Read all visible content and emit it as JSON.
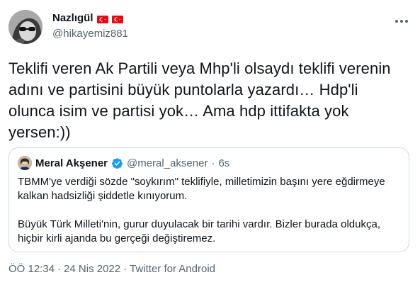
{
  "author": {
    "display_name": "Nazlıgül",
    "flags": [
      "turkey-flag",
      "turkey-flag"
    ],
    "handle": "@hikayemiz881"
  },
  "tweet": {
    "text": "Teklifi veren Ak Partili veya Mhp'li olsaydı teklifi verenin\nadını ve partisini büyük puntolarla yazardı… Hdp'li\nolunca isim ve partisi yok… Ama hdp ittifakta yok\nyersen:))"
  },
  "quoted_tweet": {
    "display_name": "Meral Akşener",
    "handle": "@meral_aksener",
    "separator": "·",
    "time": "6s",
    "paragraph1": "TBMM'ye verdiği sözde \"soykırım\" teklifiyle, milletimizin başını yere eğdirmeye kalkan hadsizliği şiddetle kınıyorum.",
    "paragraph2": "Büyük Türk Milleti'nin, gurur duyulacak bir tarihi vardır. Bizler burada oldukça, hiçbir kirli ajanda bu gerçeği değiştiremez."
  },
  "meta": {
    "time": "ÖÖ 12:34",
    "separator1": "·",
    "date": "24 Nis 2022",
    "separator2": "·",
    "source": "Twitter for Android"
  },
  "icons": {
    "more": "more-horizontal-icon",
    "verified": "verified-badge-icon"
  },
  "colors": {
    "text": "#0f1419",
    "secondary": "#536471",
    "border": "#cfd9de",
    "verified": "#1d9bf0",
    "flag_red": "#e30a17"
  }
}
